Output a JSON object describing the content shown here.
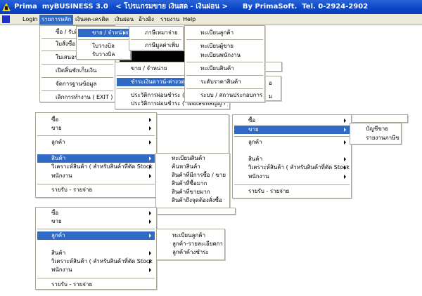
{
  "window": {
    "title": "Prima  myBUSINESS 3.0   < โปรแกรมขาย เงินสด - เงินผ่อน >      By PrimaSoft.  Tel. 0-2924-2902"
  },
  "menubar": [
    "Login",
    "รายการหลัก",
    "เงินสด-เครดิต",
    "เงินผ่อน",
    "อ้างอิง",
    "รายงาน",
    "Help"
  ],
  "menus": {
    "main": [
      "ซื้อ / รับสินค้า",
      "ใบสั่งซื้อ",
      "ใบเสนอราคา",
      "เปิดลิ้นชักเก็บเงิน",
      "จัดการฐานข้อมูล",
      "เลิกการทำงาน ( EXIT )"
    ],
    "sale": [
      "ขาย / จำหน่าย",
      "ใบวางบิล",
      "รับวางบิล"
    ],
    "tax": [
      "ภาษีเหมาจ่าย",
      "ภาษีมูลค่าเพิ่ม"
    ],
    "installment": [
      "ขาย / จำหน่าย",
      "ชำระเงินดาวน์-ค่างวด",
      "ประวัติการผ่อนชำระ ( โดยชื่อลูกค้า )",
      "ประวัติการผ่อนชำระ ( โดยเลขที่สัญญา )"
    ],
    "reference": [
      "ทะเบียนลูกค้า",
      "ทะเบียนผู้ขาย",
      "ทะเบียนพนักงาน",
      "ทะเบียนสินค้า",
      "ระดับราคาสินค้า",
      "ระบบ /  สถานประกอบการ"
    ],
    "report": [
      "ซื้อ",
      "ขาย",
      "ลูกค้า",
      "สินค้า",
      "วิเคราะห์สินค้า ( สำหรับสินค้าที่ตัด Stock )",
      "พนักงาน",
      "รายรับ - รายจ่าย"
    ],
    "product_sub": [
      "ทะเบียนสินค้า",
      "ค้นหาสินค้า",
      "สินค้าที่มีการซื้อ / ขาย",
      "สินค้าที่ซื้อมาก",
      "สินค้าที่ขายมาก",
      "สินค้าถึงจุดต้องสั่งซื้อ"
    ],
    "sale_sub": [
      "บัญชีขาย",
      "รายงานภาษีขาย"
    ],
    "customer_sub": [
      "ทะเบียนลูกค้า",
      "ลูกค้า-รายละเอียดการซื้อ",
      "ลูกค้าค้างชำระ"
    ]
  },
  "fragments": [
    "อ",
    "ม"
  ]
}
